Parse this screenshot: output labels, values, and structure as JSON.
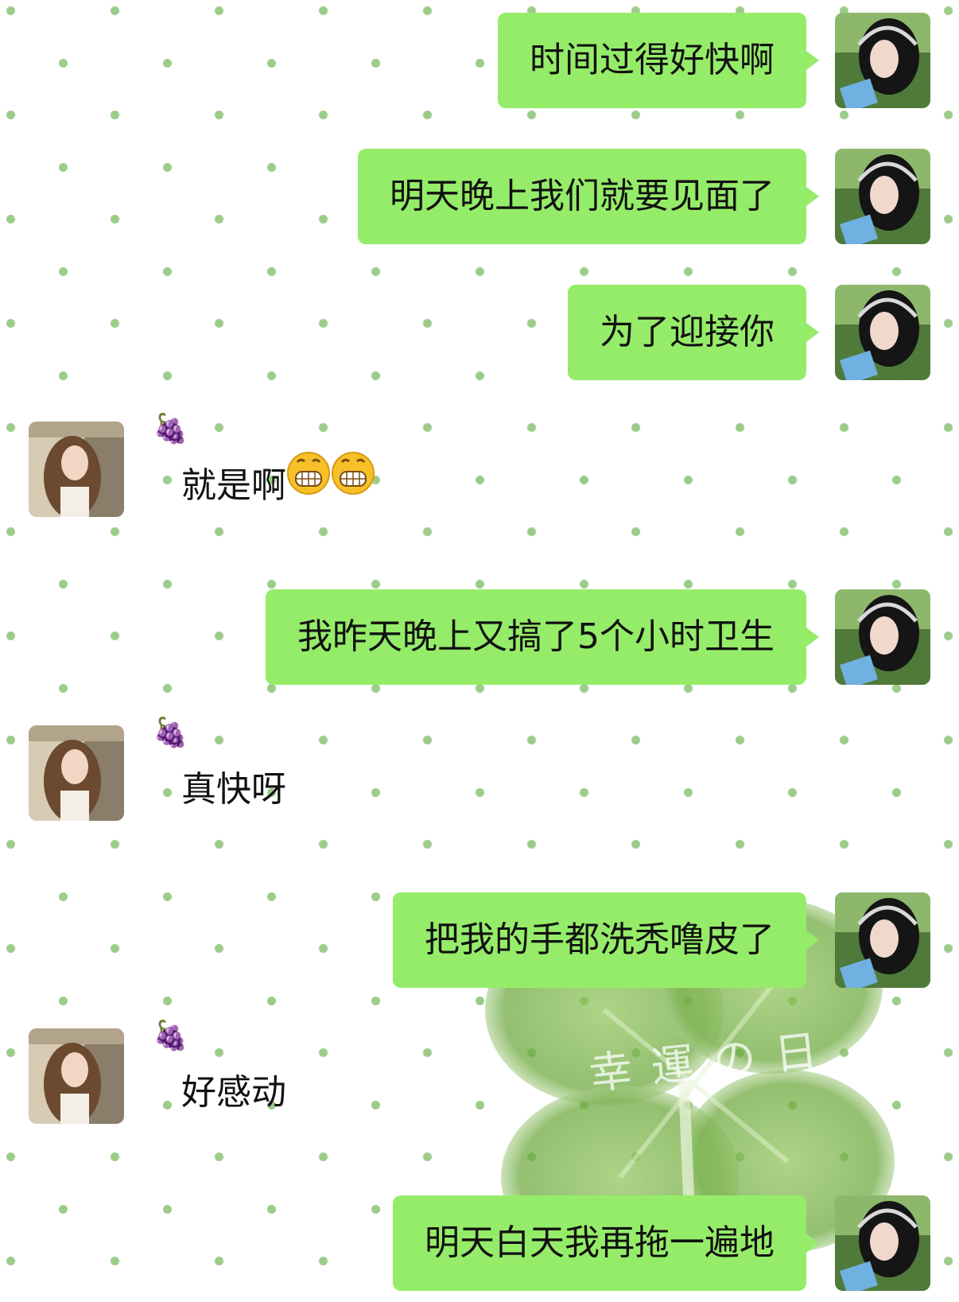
{
  "contact": {
    "nickname": "🍇"
  },
  "messages": [
    {
      "from": "me",
      "text": "时间过得好快啊"
    },
    {
      "from": "me",
      "text": "明天晚上我们就要见面了"
    },
    {
      "from": "me",
      "text": "为了迎接你"
    },
    {
      "from": "them",
      "text": "就是啊",
      "emoji": [
        "grin-emoji",
        "grin-emoji"
      ]
    },
    {
      "from": "me",
      "text": "我昨天晚上又搞了5个小时卫生"
    },
    {
      "from": "them",
      "text": "真快呀"
    },
    {
      "from": "me",
      "text": "把我的手都洗秃噜皮了"
    },
    {
      "from": "them",
      "text": "好感动"
    },
    {
      "from": "me",
      "text": "明天白天我再拖一遍地"
    }
  ],
  "background": {
    "clover_text": "幸運の日"
  },
  "colors": {
    "my_bubble": "#95ec69",
    "dot": "#9ccc8a"
  }
}
